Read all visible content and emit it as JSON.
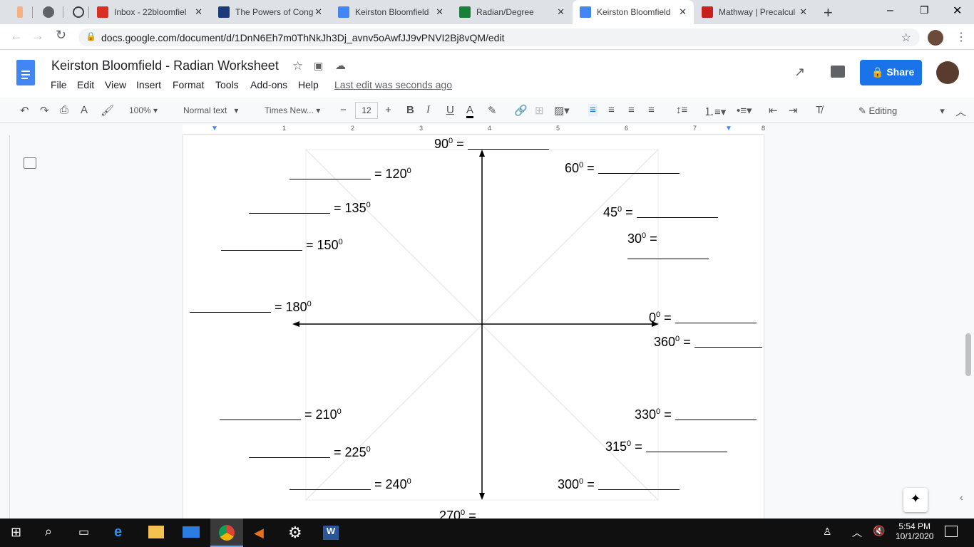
{
  "browser": {
    "tabs": [
      {
        "title": "Inbox - 22bloomfiel",
        "color": "#d93025"
      },
      {
        "title": "The Powers of Cong",
        "color": "#1a3a7a"
      },
      {
        "title": "Keirston Bloomfield",
        "color": "#4285f4"
      },
      {
        "title": "Radian/Degree",
        "color": "#188038"
      },
      {
        "title": "Keirston Bloomfield",
        "color": "#4285f4",
        "active": true
      },
      {
        "title": "Mathway | Precalcul",
        "color": "#c5221f"
      }
    ],
    "url": "docs.google.com/document/d/1DnN6Eh7m0ThNkJh3Dj_avnv5oAwfJJ9vPNVI2Bj8vQM/edit"
  },
  "docs": {
    "title": "Keirston Bloomfield - Radian Worksheet",
    "menu": [
      "File",
      "Edit",
      "View",
      "Insert",
      "Format",
      "Tools",
      "Add-ons",
      "Help"
    ],
    "last_edit": "Last edit was seconds ago",
    "share": "Share",
    "accent": "#1a73e8"
  },
  "toolbar": {
    "zoom": "100%",
    "style": "Normal text",
    "font": "Times New...",
    "size": "12",
    "mode": "Editing"
  },
  "ruler": [
    "1",
    "2",
    "3",
    "4",
    "5",
    "6",
    "7",
    "8"
  ],
  "worksheet": {
    "deg90": "90",
    "deg120": "120",
    "deg135": "135",
    "deg150": "150",
    "deg180": "180",
    "deg210": "210",
    "deg225": "225",
    "deg240": "240",
    "deg270": "270",
    "deg60": "60",
    "deg45": "45",
    "deg30": "30",
    "deg0": "0",
    "deg360": "360",
    "deg330": "330",
    "deg315": "315",
    "deg300": "300",
    "sup": "0",
    "eq": "="
  },
  "taskbar": {
    "time": "5:54 PM",
    "date": "10/1/2020"
  }
}
